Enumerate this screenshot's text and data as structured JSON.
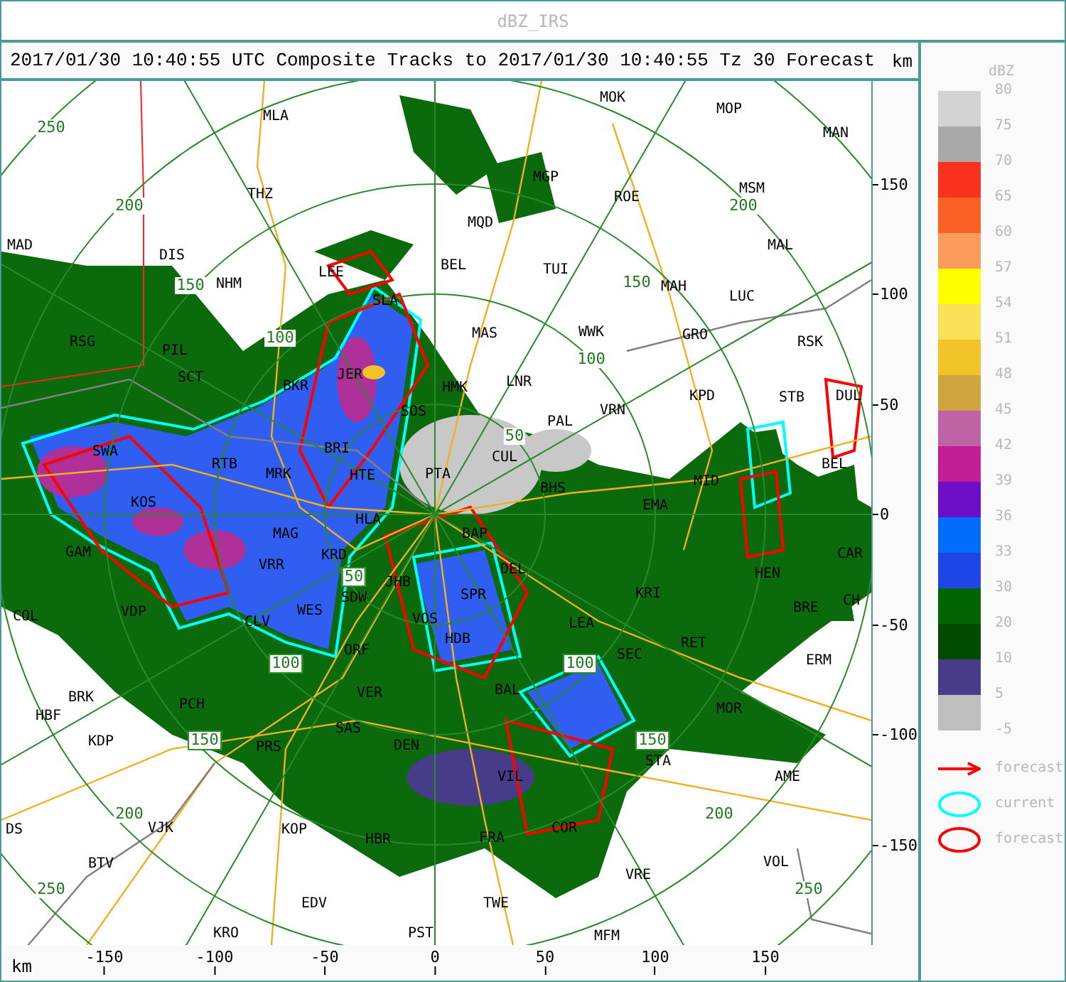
{
  "window": {
    "title": "dBZ_IRS"
  },
  "plot": {
    "title": "2017/01/30 10:40:55 UTC Composite Tracks to 2017/01/30 10:40:55 Tz 30 Forecast",
    "y_unit": "km",
    "x_unit": "km",
    "xticks": [
      "-150",
      "-100",
      "-50",
      "0",
      "50",
      "100",
      "150"
    ],
    "yticks": [
      "150",
      "100",
      "50",
      "0",
      "-50",
      "-100",
      "-150"
    ],
    "ring_labels": [
      {
        "text": "250",
        "boxed": false
      },
      {
        "text": "200",
        "boxed": false
      },
      {
        "text": "200",
        "boxed": false
      },
      {
        "text": "150",
        "boxed": false
      },
      {
        "text": "150",
        "boxed": false
      },
      {
        "text": "100",
        "boxed": false
      },
      {
        "text": "100",
        "boxed": false
      },
      {
        "text": "50",
        "boxed": false
      },
      {
        "text": "50",
        "boxed": true
      },
      {
        "text": "100",
        "boxed": true
      },
      {
        "text": "100",
        "boxed": true
      },
      {
        "text": "150",
        "boxed": true
      },
      {
        "text": "150",
        "boxed": true
      },
      {
        "text": "200",
        "boxed": false
      },
      {
        "text": "200",
        "boxed": false
      },
      {
        "text": "250",
        "boxed": false
      },
      {
        "text": "250",
        "boxed": false
      }
    ],
    "stations": [
      "MLA",
      "MOK",
      "MOP",
      "MAN",
      "THZ",
      "MGP",
      "ROE",
      "MSM",
      "MQD",
      "MAD",
      "DIS",
      "MAL",
      "LEE",
      "BEL",
      "TUI",
      "NHM",
      "SLA",
      "MAH",
      "LUC",
      "RSG",
      "PIL",
      "MAS",
      "WWK",
      "GRO",
      "RSK",
      "SCT",
      "BKR",
      "JER",
      "HMK",
      "LNR",
      "KPD",
      "STB",
      "DUL",
      "SOS",
      "PAL",
      "VRN",
      "SWA",
      "RTB",
      "BRI",
      "CUL",
      "BEL",
      "MRK",
      "HTE",
      "PTA",
      "MID",
      "BHS",
      "KOS",
      "EMA",
      "MAG",
      "HLA",
      "BAP",
      "GAM",
      "VRR",
      "KRD",
      "DEL",
      "HEN",
      "CAR",
      "SDW",
      "JHB",
      "SPR",
      "KRI",
      "CH",
      "COL",
      "VDP",
      "CLV",
      "WES",
      "VOS",
      "LEA",
      "BRE",
      "ORF",
      "HDB",
      "SEC",
      "RET",
      "ERM",
      "HBF",
      "BRK",
      "PCH",
      "VER",
      "BAL",
      "MOR",
      "KDP",
      "PRS",
      "SAS",
      "DEN",
      "VIL",
      "STA",
      "AME",
      "DS",
      "VJK",
      "KOP",
      "HBR",
      "FRA",
      "COR",
      "BTV",
      "VRE",
      "VOL",
      "EDV",
      "TWE",
      "KRO",
      "PST",
      "MFM"
    ]
  },
  "legend": {
    "unit": "dBZ",
    "swatches": [
      {
        "color": "#d3d3d3"
      },
      {
        "color": "#a9a9a9"
      },
      {
        "color": "#fa321e"
      },
      {
        "color": "#fa5f23"
      },
      {
        "color": "#fa9b5a"
      },
      {
        "color": "#ffff00"
      },
      {
        "color": "#fae15a"
      },
      {
        "color": "#f0c328"
      },
      {
        "color": "#cda53c"
      },
      {
        "color": "#be64a5"
      },
      {
        "color": "#c31e96"
      },
      {
        "color": "#6e0fc8"
      },
      {
        "color": "#006efa"
      },
      {
        "color": "#1e46e6"
      },
      {
        "color": "#006400"
      },
      {
        "color": "#004b00"
      },
      {
        "color": "#463c87"
      },
      {
        "color": "#bebebe"
      }
    ],
    "labels": [
      "80",
      "75",
      "70",
      "65",
      "60",
      "57",
      "54",
      "51",
      "48",
      "45",
      "42",
      "39",
      "36",
      "33",
      "30",
      "20",
      "10",
      "5",
      "-5"
    ],
    "keys": [
      {
        "kind": "arrow",
        "label": "forecast"
      },
      {
        "kind": "current-outline",
        "label": "current"
      },
      {
        "kind": "forecast-outline",
        "label": "forecast"
      }
    ]
  }
}
